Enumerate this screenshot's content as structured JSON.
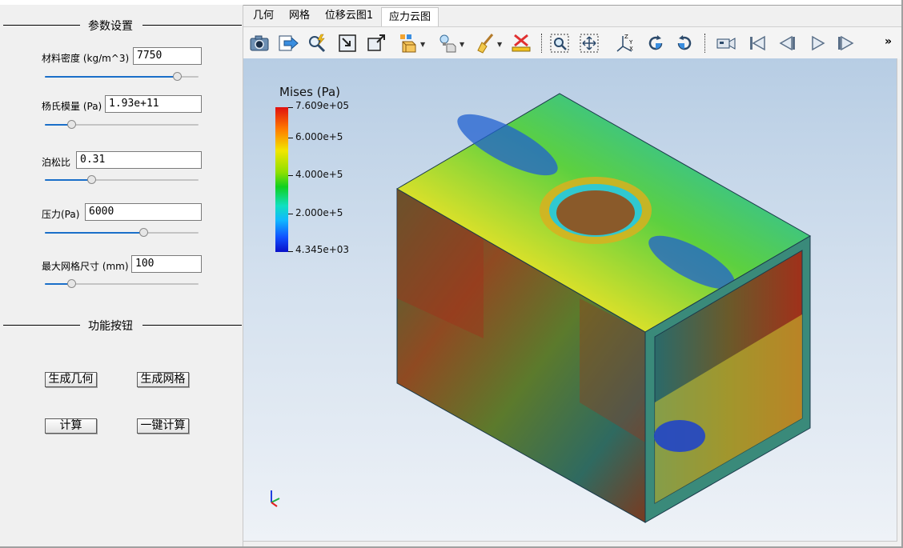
{
  "params": {
    "section_title": "参数设置",
    "fields": [
      {
        "label": "材料密度 (kg/m^3)",
        "value": "7750",
        "slider": 0.86
      },
      {
        "label": "杨氏模量 (Pa)",
        "value": "1.93e+11",
        "slider": 0.17
      },
      {
        "label": "泊松比",
        "value": "0.31",
        "slider": 0.3
      },
      {
        "label": "压力(Pa)",
        "value": "6000",
        "slider": 0.64
      },
      {
        "label": "最大网格尺寸 (mm)",
        "value": "100",
        "slider": 0.17
      }
    ]
  },
  "functions": {
    "section_title": "功能按钮",
    "buttons": [
      "生成几何",
      "生成网格",
      "计算",
      "一键计算"
    ]
  },
  "tabs": [
    "几何",
    "网格",
    "位移云图1",
    "应力云图"
  ],
  "active_tab": "应力云图",
  "toolbar": {
    "icons": [
      "camera-icon",
      "export-icon",
      "quick-zoom-icon",
      "zoom-box-icon",
      "fit-view-icon",
      "display-mode-icon",
      "light-icon",
      "clear-brush-icon",
      "remove-icon",
      "zoom-region-icon",
      "pan-icon",
      "axes-icon",
      "rotate-cw-icon",
      "rotate-ccw-icon",
      "record-camera-icon",
      "first-frame-icon",
      "prev-frame-icon",
      "play-icon",
      "last-frame-icon"
    ],
    "more": "»"
  },
  "legend": {
    "title": "Mises (Pa)",
    "labels": [
      "7.609e+05",
      "6.000e+5",
      "4.000e+5",
      "2.000e+5",
      "4.345e+03"
    ]
  }
}
